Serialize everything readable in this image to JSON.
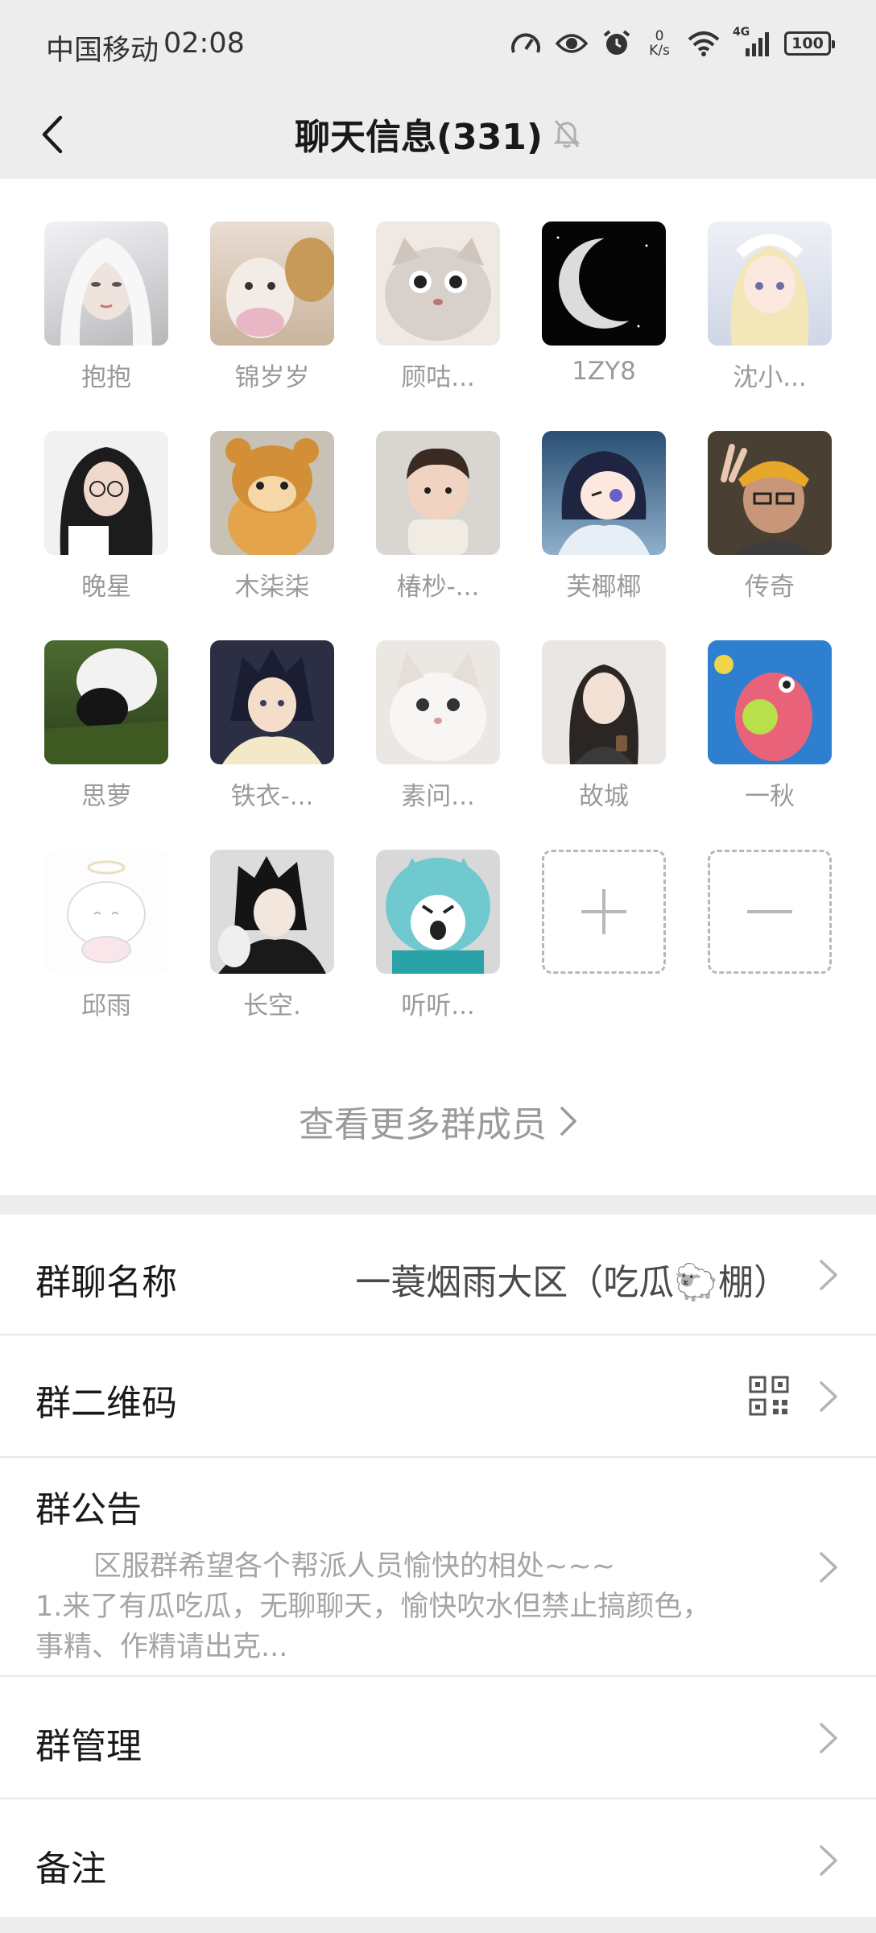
{
  "status_bar": {
    "carrier": "中国移动",
    "time": "02:08",
    "net_speed_value": "0",
    "net_speed_unit": "K/s",
    "network": "4G",
    "battery": "100"
  },
  "nav": {
    "title": "聊天信息(331)"
  },
  "members": [
    {
      "name": "抱抱"
    },
    {
      "name": "锦岁岁"
    },
    {
      "name": "顾咕..."
    },
    {
      "name": "1ZY8"
    },
    {
      "name": "沈小..."
    },
    {
      "name": "晚星"
    },
    {
      "name": "木柒柒"
    },
    {
      "name": "椿杪-..."
    },
    {
      "name": "芙椰椰"
    },
    {
      "name": "传奇"
    },
    {
      "name": "思萝"
    },
    {
      "name": "铁衣-..."
    },
    {
      "name": "素问..."
    },
    {
      "name": "故城"
    },
    {
      "name": "一秋"
    },
    {
      "name": "邱雨"
    },
    {
      "name": "长空."
    },
    {
      "name": "听听..."
    }
  ],
  "more_members": "查看更多群成员",
  "settings": {
    "group_name_label": "群聊名称",
    "group_name_value": "一蓑烟雨大区（吃瓜🐑棚）",
    "qr_label": "群二维码",
    "notice_label": "群公告",
    "notice_line1": "区服群希望各个帮派人员愉快的相处~~~",
    "notice_line2": "1.来了有瓜吃瓜，无聊聊天，愉快吹水但禁止搞颜色，",
    "notice_line3": "事精、作精请出克...",
    "manage_label": "群管理",
    "remark_label": "备注"
  },
  "colors": {
    "background": "#ededed",
    "panel": "#ffffff",
    "muted_text": "#9a9a9a"
  }
}
